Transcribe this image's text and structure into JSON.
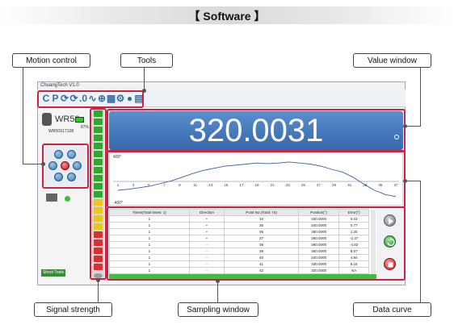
{
  "header": {
    "title": "【 Software 】"
  },
  "callouts": {
    "motion_control": "Motion control",
    "tools": "Tools",
    "value_window": "Value window",
    "signal_strength": "Signal strength",
    "sampling_window": "Sampling window",
    "data_curve": "Data curve"
  },
  "window": {
    "title": "ChuangTech V1.0"
  },
  "toolbar": {
    "icons": [
      "C",
      "P",
      "⟳",
      "⟳",
      ".0",
      "∿",
      "⊕",
      "▦",
      "⚙",
      "●",
      "▤"
    ],
    "icon_names": [
      "calibrate-icon",
      "p-icon",
      "refresh-icon",
      "cycle-icon",
      "decimal-icon",
      "wave-icon",
      "target-icon",
      "table-icon",
      "gear-icon",
      "circle-icon",
      "export-icon"
    ]
  },
  "device": {
    "name": "WR50",
    "battery": "87%",
    "serial": "WR50S17108"
  },
  "shoot_button": "Shoot Tools",
  "value": {
    "reading": "320.0031"
  },
  "chart_data": {
    "type": "line",
    "ylabel_top": "400°",
    "ylabel_bottom": "-400°",
    "x_ticks": [
      "1",
      "3",
      "5",
      "7",
      "9",
      "11",
      "13",
      "15",
      "17",
      "19",
      "21",
      "23",
      "25",
      "27",
      "29",
      "31",
      "33",
      "35",
      "37"
    ],
    "series": [
      {
        "values": [
          20,
          22,
          25,
          28,
          33,
          38,
          45,
          52,
          58,
          62,
          66,
          68,
          70,
          72,
          71,
          72,
          74,
          72,
          70,
          66,
          60,
          55,
          45,
          32,
          20,
          12,
          8
        ]
      }
    ],
    "x_start": 1,
    "x_end": 37
  },
  "table": {
    "headers": [
      "Times(Total times: 1)",
      "Direction",
      "Point No.(Total: 74)",
      "Position(°)",
      "Error(°)"
    ],
    "rows": [
      [
        "1",
        "+",
        "34",
        "330.0000",
        "0.03"
      ],
      [
        "1",
        "+",
        "35",
        "340.0000",
        "0.77"
      ],
      [
        "1",
        "+",
        "36",
        "350.0000",
        "1.25"
      ],
      [
        "1",
        "+",
        "37",
        "360.0000",
        "-2.37"
      ],
      [
        "1",
        "-",
        "38",
        "360.0000",
        "-4.82"
      ],
      [
        "1",
        "-",
        "39",
        "350.0000",
        "5.07"
      ],
      [
        "1",
        "-",
        "40",
        "340.0000",
        "4.94"
      ],
      [
        "1",
        "-",
        "41",
        "330.0000",
        "6.15"
      ],
      [
        "1",
        "-",
        "42",
        "320.0000",
        "NA"
      ],
      [
        "1",
        "-",
        "43",
        "310.0000",
        "NA"
      ]
    ]
  },
  "colors": {
    "highlight": "#d02040",
    "value_bg": "#3f72b6",
    "signal_green": "#2fa82f",
    "signal_yellow": "#e8c81f",
    "signal_red": "#d83030"
  }
}
